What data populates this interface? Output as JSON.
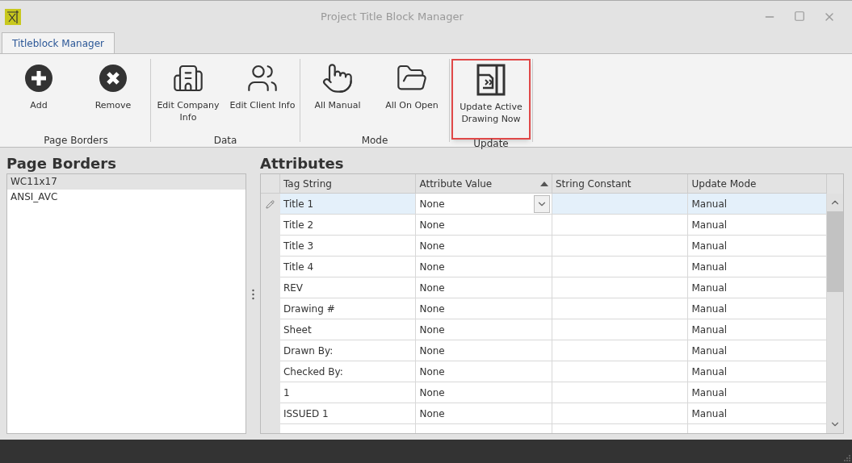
{
  "window": {
    "title": "Project Title Block Manager"
  },
  "tabs": [
    {
      "label": "Titleblock Manager",
      "selected": true
    }
  ],
  "ribbon_groups": [
    {
      "label": "Page Borders",
      "buttons": [
        {
          "kind": "add",
          "label": "Add",
          "highlighted": false
        },
        {
          "kind": "remove",
          "label": "Remove",
          "highlighted": false
        }
      ]
    },
    {
      "label": "Data",
      "buttons": [
        {
          "kind": "company",
          "label": "Edit Company Info",
          "highlighted": false
        },
        {
          "kind": "client",
          "label": "Edit Client Info",
          "highlighted": false
        }
      ]
    },
    {
      "label": "Mode",
      "buttons": [
        {
          "kind": "manual",
          "label": "All Manual",
          "highlighted": false
        },
        {
          "kind": "open",
          "label": "All On Open",
          "highlighted": false
        }
      ]
    },
    {
      "label": "Update",
      "buttons": [
        {
          "kind": "update",
          "label": "Update Active Drawing Now",
          "highlighted": true
        }
      ]
    }
  ],
  "page_borders": {
    "title": "Page Borders",
    "items": [
      {
        "label": "WC11x17",
        "selected": true
      },
      {
        "label": "ANSI_AVC",
        "selected": false
      }
    ]
  },
  "attributes": {
    "title": "Attributes",
    "columns": [
      {
        "label": "Tag String"
      },
      {
        "label": "Attribute Value",
        "sorted": true
      },
      {
        "label": "String Constant"
      },
      {
        "label": "Update Mode"
      }
    ],
    "rows": [
      {
        "cells": [
          "Title 1",
          "None",
          "",
          "Manual"
        ],
        "selected": true
      },
      {
        "cells": [
          "Title 2",
          "None",
          "",
          "Manual"
        ],
        "selected": false
      },
      {
        "cells": [
          "Title 3",
          "None",
          "",
          "Manual"
        ],
        "selected": false
      },
      {
        "cells": [
          "Title 4",
          "None",
          "",
          "Manual"
        ],
        "selected": false
      },
      {
        "cells": [
          "REV",
          "None",
          "",
          "Manual"
        ],
        "selected": false
      },
      {
        "cells": [
          "Drawing #",
          "None",
          "",
          "Manual"
        ],
        "selected": false
      },
      {
        "cells": [
          "Sheet",
          "None",
          "",
          "Manual"
        ],
        "selected": false
      },
      {
        "cells": [
          "Drawn By:",
          "None",
          "",
          "Manual"
        ],
        "selected": false
      },
      {
        "cells": [
          "Checked By:",
          "None",
          "",
          "Manual"
        ],
        "selected": false
      },
      {
        "cells": [
          "1",
          "None",
          "",
          "Manual"
        ],
        "selected": false
      },
      {
        "cells": [
          "ISSUED 1",
          "None",
          "",
          "Manual"
        ],
        "selected": false
      }
    ]
  }
}
